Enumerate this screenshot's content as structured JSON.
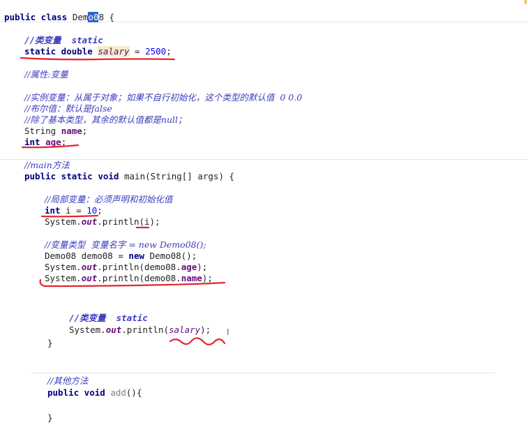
{
  "lines": {
    "class_decl_a": "public class ",
    "class_decl_name_a": "Dem",
    "class_decl_name_sel": "o0",
    "class_decl_name_b": "8",
    "class_decl_brace": " {",
    "c_classvar": "//类变量  static",
    "salary_kw": "static double ",
    "salary_name": "salary",
    "salary_eq": " = ",
    "salary_val": "2500",
    "salary_semi": ";",
    "c_attr": "//属性:变量",
    "c_instance": "//实例变量：从属于对象；如果不自行初始化，这个类型的默认值  0 0.0",
    "c_bool": "//布尔值：默认是false",
    "c_ref": "//除了基本类型，其余的默认值都是null；",
    "name_type": "String ",
    "name_var": "name",
    "name_semi": ";",
    "age_type": "int ",
    "age_var": "age",
    "age_semi": ";",
    "c_main": "//main方法",
    "main_kw": "public static void ",
    "main_sig": "main(String[] args) {",
    "c_local": "//局部变量：必须声明和初始化值",
    "i_type": "int ",
    "i_rest": "i = ",
    "i_val": "10",
    "i_semi": ";",
    "sys1_a": "System.",
    "sys_out": "out",
    "sys1_b": ".println(i);",
    "c_vartype": "//变量类型  变量名字 = new Demo08();",
    "demo_a": "Demo08 demo08 = ",
    "demo_new": "new",
    "demo_b": " Demo08();",
    "sys2_b": ".println(demo08.",
    "sys2_fld": "age",
    "sys2_c": ");",
    "sys3_fld": "name",
    "c_classvar2": "//类变量  static",
    "sys4_b": ".println(",
    "sys4_fld": "salary",
    "close_brace": "}",
    "c_other": "//其他方法",
    "add_kw": "public void ",
    "add_name": "add",
    "add_rest": "(){",
    "cursor_glyph": "I"
  }
}
